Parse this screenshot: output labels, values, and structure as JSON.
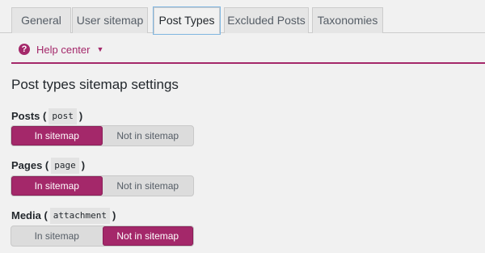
{
  "tabs": [
    {
      "label": "General"
    },
    {
      "label": "User sitemap"
    },
    {
      "label": "Post Types"
    },
    {
      "label": "Excluded Posts"
    },
    {
      "label": "Taxonomies"
    }
  ],
  "active_tab": "Post Types",
  "help": {
    "icon": "?",
    "label": "Help center",
    "caret": "▼"
  },
  "section_title": "Post types sitemap settings",
  "fields": [
    {
      "label": "Posts",
      "code": "post",
      "options": [
        "In sitemap",
        "Not in sitemap"
      ],
      "selected": "In sitemap"
    },
    {
      "label": "Pages",
      "code": "page",
      "options": [
        "In sitemap",
        "Not in sitemap"
      ],
      "selected": "In sitemap"
    },
    {
      "label": "Media",
      "code": "attachment",
      "options": [
        "In sitemap",
        "Not in sitemap"
      ],
      "selected": "Not in sitemap"
    }
  ],
  "colors": {
    "accent": "#a4286a",
    "background": "#f1f1f1",
    "tab_bg": "#e5e5e5"
  }
}
